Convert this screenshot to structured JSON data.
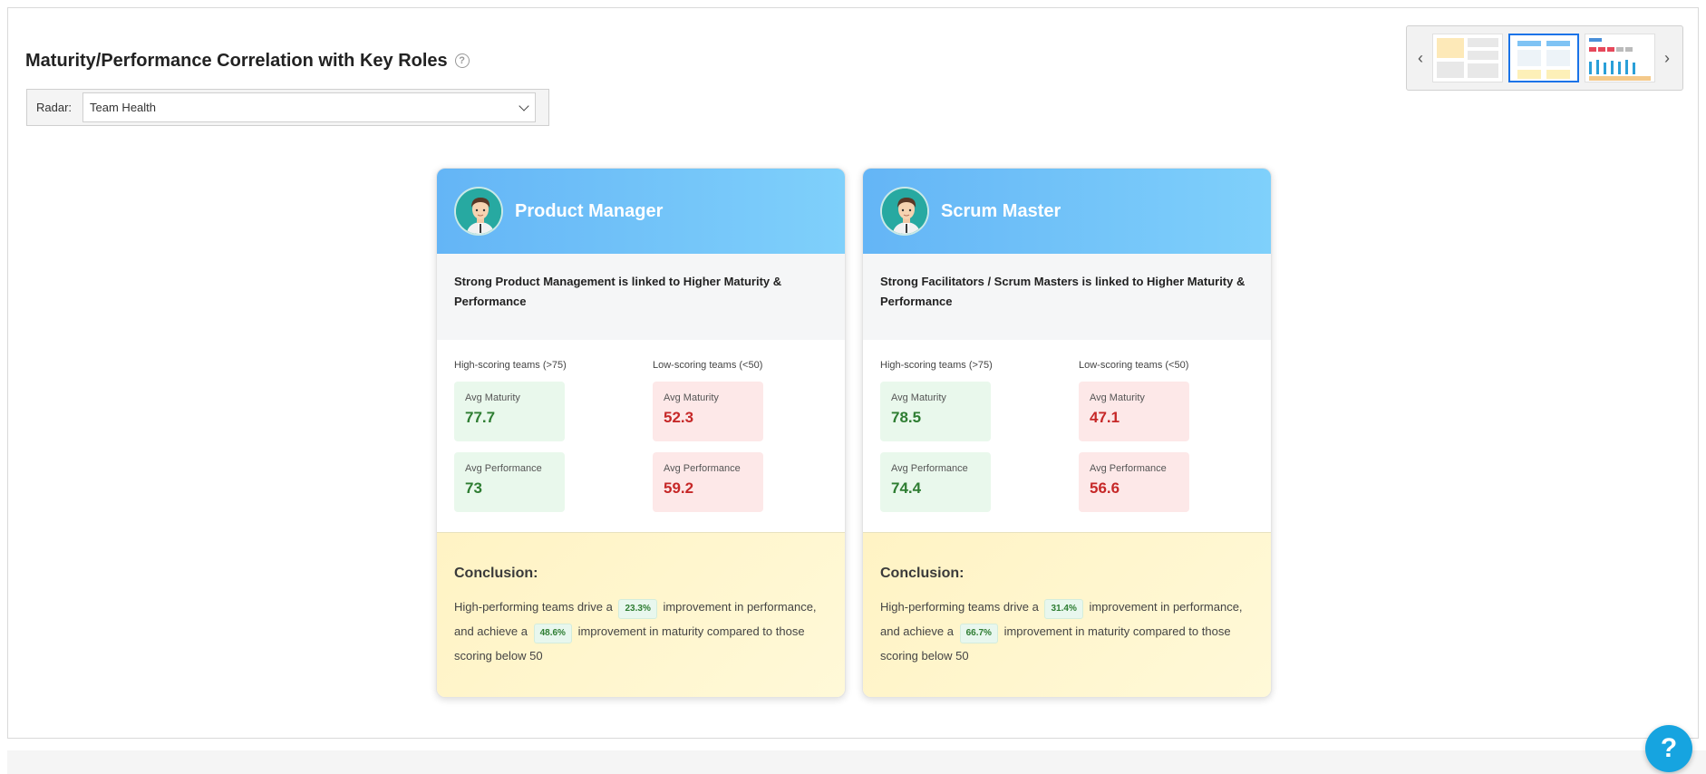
{
  "page": {
    "title": "Maturity/Performance Correlation with Key Roles",
    "help_glyph": "?"
  },
  "radar": {
    "label": "Radar:",
    "selected": "Team Health"
  },
  "thumbnails": {
    "prev_glyph": "‹",
    "next_glyph": "›",
    "active_index": 1
  },
  "cards": [
    {
      "role": "Product Manager",
      "statement": "Strong Product Management is linked to Higher Maturity & Performance",
      "high_header": "High-scoring teams (>75)",
      "low_header": "Low-scoring teams (<50)",
      "high": {
        "maturity_label": "Avg Maturity",
        "maturity": "77.7",
        "performance_label": "Avg Performance",
        "performance": "73"
      },
      "low": {
        "maturity_label": "Avg Maturity",
        "maturity": "52.3",
        "performance_label": "Avg Performance",
        "performance": "59.2"
      },
      "conclusion_title": "Conclusion:",
      "c1": "High-performing teams drive a",
      "perf_pct": "23.3%",
      "c2": "improvement in performance, and achieve a",
      "mat_pct": "48.6%",
      "c3": "improvement in maturity compared to those scoring below 50"
    },
    {
      "role": "Scrum Master",
      "statement": "Strong Facilitators / Scrum Masters is linked to Higher Maturity & Performance",
      "high_header": "High-scoring teams (>75)",
      "low_header": "Low-scoring teams (<50)",
      "high": {
        "maturity_label": "Avg Maturity",
        "maturity": "78.5",
        "performance_label": "Avg Performance",
        "performance": "74.4"
      },
      "low": {
        "maturity_label": "Avg Maturity",
        "maturity": "47.1",
        "performance_label": "Avg Performance",
        "performance": "56.6"
      },
      "conclusion_title": "Conclusion:",
      "c1": "High-performing teams drive a",
      "perf_pct": "31.4%",
      "c2": "improvement in performance, and achieve a",
      "mat_pct": "66.7%",
      "c3": "improvement in maturity compared to those scoring below 50"
    }
  ],
  "help_fab": "?",
  "colors": {
    "header_gradient_start": "#64b5f6",
    "header_gradient_end": "#7fd0fb",
    "good": "#2e7d32",
    "bad": "#c62828",
    "fab": "#16a4e0"
  }
}
